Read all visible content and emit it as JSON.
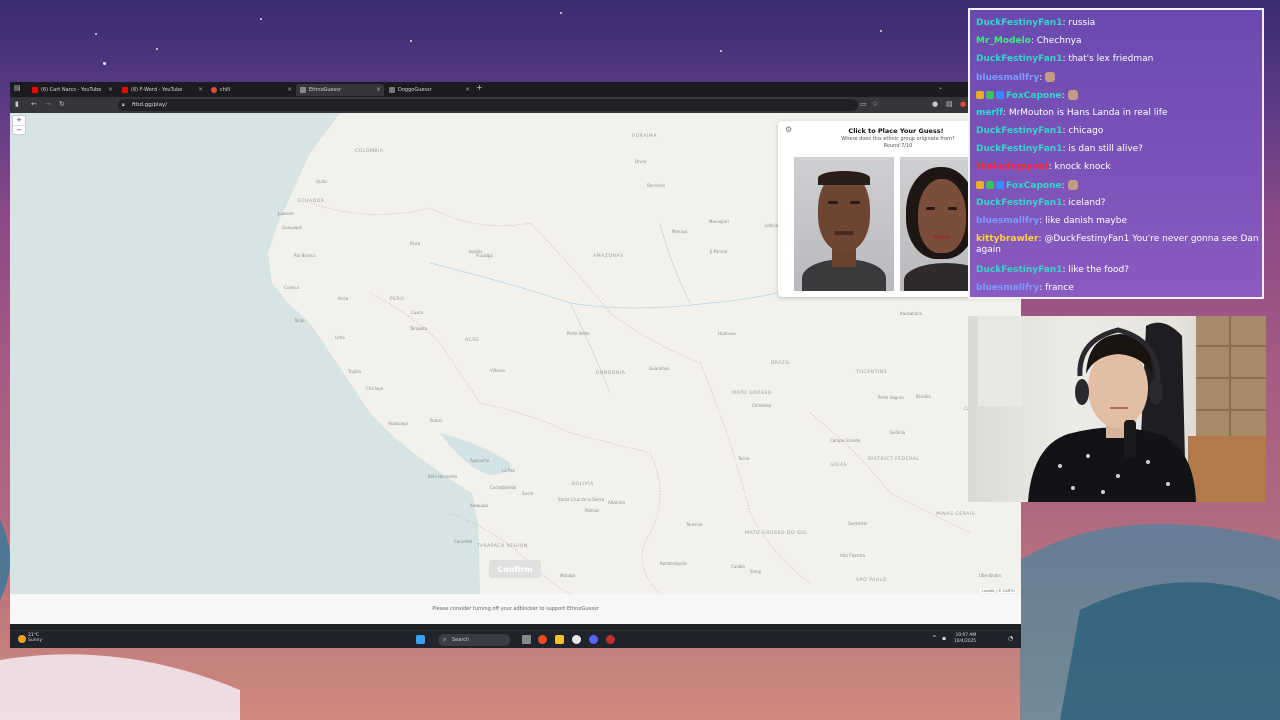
{
  "browser": {
    "tabs": [
      {
        "label": "(6) Cart Narcs - YouTube",
        "fav_color": "#ff0000",
        "active": false
      },
      {
        "label": "(6) F-Word - YouTube",
        "fav_color": "#ff0000",
        "active": false
      },
      {
        "label": "chill",
        "fav_color": "#e84a3a",
        "active": false
      },
      {
        "label": "EthnoGuessr",
        "fav_color": "#888888",
        "active": true
      },
      {
        "label": "DoggoGuessr",
        "fav_color": "#777777",
        "active": false
      }
    ],
    "url": "ftbd.gg/play/"
  },
  "map": {
    "labels": [
      "COLOMBIA",
      "ECUADOR",
      "PERU",
      "AMAZONAS",
      "BRAZIL",
      "ACRE",
      "RONDÔNIA",
      "MATO GROSSO",
      "BOLIVIA",
      "GOIÁS",
      "DISTRICT FEDERAL",
      "MINAS GERAIS",
      "MATO GROSSO DO SUL",
      "SÃO PAULO",
      "TARAPACA REGION",
      "RORAIMA",
      "TOCANTINS",
      "Quito",
      "Cuenca",
      "Guayaquil",
      "Iquitos",
      "Manaus",
      "Porto Velho",
      "Lima",
      "Cusco",
      "La Paz",
      "Santa Cruz de la Sierra",
      "Cuiabá",
      "Campo Grande",
      "Goiânia",
      "Brasília",
      "Belo Horizonte",
      "Arequipa",
      "Arica",
      "Trujillo",
      "Rio Branco",
      "Chiclayo",
      "Huancayo",
      "Ayacucho",
      "Palmas",
      "Sucre",
      "Cochabamba",
      "Oruro",
      "Manaquiri",
      "Santarém",
      "Uberlândia",
      "Guarulhos",
      "Vilhena",
      "Ji-Paraná",
      "Juazeiro",
      "Piura",
      "Tarapoto",
      "Pucallpa",
      "Caquetá",
      "Leticia",
      "Porto Seguro",
      "Itacoatiara",
      "Barreiras",
      "Teresina",
      "Marabá",
      "Altamira",
      "Corumbá",
      "Tarija",
      "Potosí",
      "Tacna",
      "Chimbote",
      "Huánuco",
      "Rondonópolis",
      "Sinop",
      "Alta Floresta"
    ],
    "confirm_label": "Confirm",
    "attribution": "Leaflet | © CARTO",
    "zoom_in": "+",
    "zoom_out": "−"
  },
  "panel": {
    "title": "Click to Place Your Guess!",
    "subtitle": "Where does this ethnic group originate from?",
    "round": "Round 7/10"
  },
  "adbar": {
    "text": "Please consider turning off your adblocker to support EthnoGuessr"
  },
  "taskbar": {
    "weather_temp": "21°C",
    "weather_desc": "Sunny",
    "search": "Search",
    "time": "10:07 AM",
    "date": "10/4/2025"
  },
  "chat": {
    "messages": [
      {
        "user": "DuckFestinyFan1",
        "color": "#35d6c9",
        "text": "russia",
        "badges": []
      },
      {
        "user": "Mr_Modelo",
        "color": "#3aef7a",
        "text": "Chechnya",
        "badges": []
      },
      {
        "user": "DuckFestinyFan1",
        "color": "#35d6c9",
        "text": "that's lex friedman",
        "badges": []
      },
      {
        "user": "bluesmallfry",
        "color": "#7a9cff",
        "text": "",
        "badges": [],
        "emote": true
      },
      {
        "user": "FoxCapone",
        "color": "#35d6c9",
        "text": "",
        "badges": [
          "#e8b020",
          "#40c060",
          "#3a8aff"
        ],
        "emote": true
      },
      {
        "user": "merlf",
        "color": "#2ae0d0",
        "text": "MrMouton is Hans Landa in real life",
        "badges": []
      },
      {
        "user": "DuckFestinyFan1",
        "color": "#35d6c9",
        "text": "chicago",
        "badges": []
      },
      {
        "user": "DuckFestinyFan1",
        "color": "#35d6c9",
        "text": "is dan still alive?",
        "badges": []
      },
      {
        "user": "thelachoppost",
        "color": "#ff2a40",
        "text": "knock knock",
        "badges": []
      },
      {
        "user": "FoxCapone",
        "color": "#35d6c9",
        "text": "",
        "badges": [
          "#e8b020",
          "#40c060",
          "#3a8aff"
        ],
        "emote": true
      },
      {
        "user": "DuckFestinyFan1",
        "color": "#35d6c9",
        "text": "iceland?",
        "badges": []
      },
      {
        "user": "bluesmallfry",
        "color": "#7a9cff",
        "text": "like danish maybe",
        "badges": []
      },
      {
        "user": "kittybrawler",
        "color": "#ffd23a",
        "text": "@DuckFestinyFan1 You're never gonna see Dan again",
        "badges": []
      },
      {
        "user": "DuckFestinyFan1",
        "color": "#35d6c9",
        "text": "like the food?",
        "badges": []
      },
      {
        "user": "bluesmallfry",
        "color": "#7a9cff",
        "text": "france",
        "badges": []
      }
    ]
  }
}
